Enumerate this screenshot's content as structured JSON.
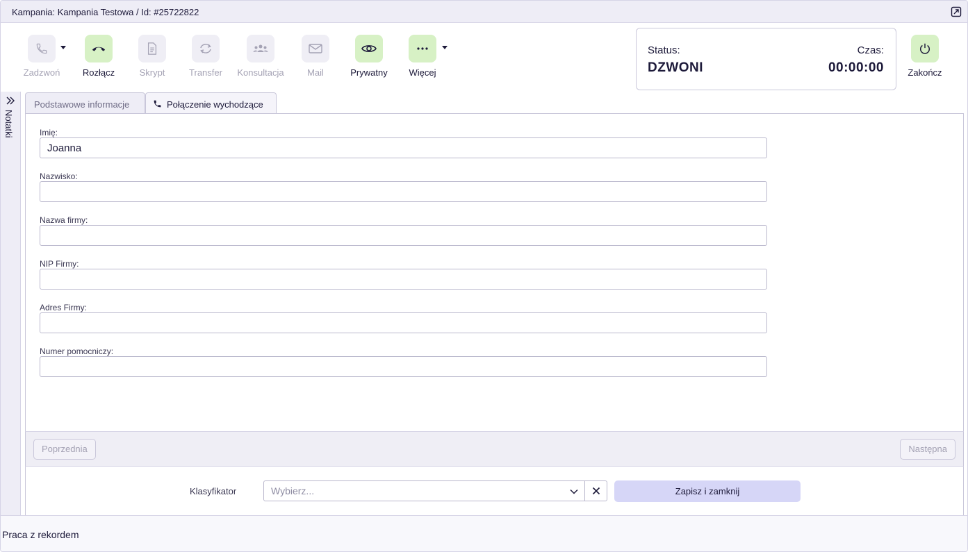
{
  "titlebar": {
    "title": "Kampania: Kampania Testowa / Id: #25722822",
    "popout_icon": "popout-icon"
  },
  "toolbar": {
    "buttons": [
      {
        "label": "Zadzwoń",
        "icon": "phone-icon",
        "active": false
      },
      {
        "label": "Rozłącz",
        "icon": "hangup-icon",
        "active": true
      },
      {
        "label": "Skrypt",
        "icon": "document-icon",
        "active": false
      },
      {
        "label": "Transfer",
        "icon": "transfer-icon",
        "active": false
      },
      {
        "label": "Konsultacja",
        "icon": "group-icon",
        "active": false
      },
      {
        "label": "Mail",
        "icon": "mail-icon",
        "active": false
      },
      {
        "label": "Prywatny",
        "icon": "eye-icon",
        "active": true
      },
      {
        "label": "Więcej",
        "icon": "more-icon",
        "active": true
      },
      {
        "label": "Zakończ",
        "icon": "power-icon",
        "active": true
      }
    ],
    "status_label": "Status:",
    "status_value": "DZWONI",
    "time_label": "Czas:",
    "time_value": "00:00:00"
  },
  "notes": {
    "label": "Notatki"
  },
  "tabs": [
    {
      "label": "Podstawowe informacje",
      "active": false
    },
    {
      "label": "Połączenie wychodzące",
      "active": true,
      "icon": "phone-icon"
    }
  ],
  "form": {
    "fields": [
      {
        "label": "Imię:",
        "value": "Joanna"
      },
      {
        "label": "Nazwisko:",
        "value": ""
      },
      {
        "label": "Nazwa firmy:",
        "value": ""
      },
      {
        "label": "NIP Firmy:",
        "value": ""
      },
      {
        "label": "Adres Firmy:",
        "value": ""
      },
      {
        "label": "Numer pomocniczy:",
        "value": ""
      }
    ]
  },
  "navigation": {
    "prev_label": "Poprzednia",
    "next_label": "Następna"
  },
  "classifier": {
    "label": "Klasyfikator",
    "placeholder": "Wybierz...",
    "save_label": "Zapisz i zamknij"
  },
  "footer": {
    "text": "Praca z rekordem"
  },
  "colors": {
    "accent_green": "#d7f1c5",
    "save_button": "#d6d6f7",
    "text_dark": "#1d1a3a",
    "text_disabled": "#a4a2b4"
  }
}
